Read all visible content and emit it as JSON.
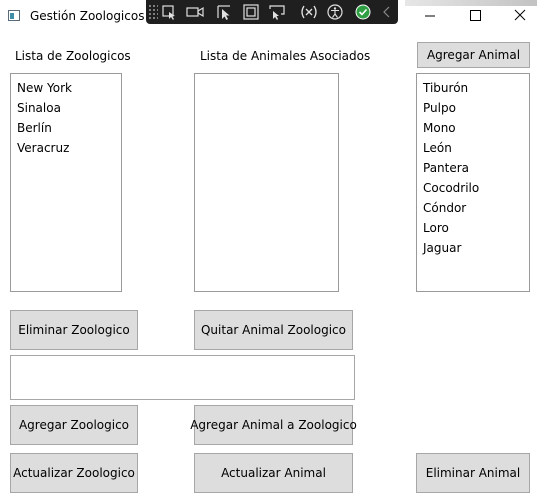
{
  "window": {
    "title": "Gestión Zoologicos",
    "icons": {
      "app": "app-window-icon",
      "minimize": "minimize-icon",
      "maximize": "maximize-icon",
      "close": "close-icon"
    }
  },
  "debug_toolbar": {
    "icons": [
      "select-element-icon",
      "video-record-icon",
      "pointer-select-icon",
      "display-layout-adorners-icon",
      "track-focus-icon",
      "binding-failures-icon",
      "accessibility-icon",
      "hot-reload-check-icon",
      "collapse-chevron-icon"
    ]
  },
  "labels": {
    "zoo_list": "Lista de Zoologicos",
    "animals_list": "Lista de Animales Asociados"
  },
  "zoos": [
    "New York",
    "Sinaloa",
    "Berlín",
    "Veracruz"
  ],
  "associated_animals": [],
  "animals": [
    "Tiburón",
    "Pulpo",
    "Mono",
    "León",
    "Pantera",
    "Cocodrilo",
    "Cóndor",
    "Loro",
    "Jaguar"
  ],
  "input": {
    "value": ""
  },
  "buttons": {
    "add_animal": "Agregar Animal",
    "delete_zoo": "Eliminar Zoologico",
    "remove_zoo_animal": "Quitar Animal Zoologico",
    "add_zoo": "Agregar Zoologico",
    "add_animal_to_zoo": "Agregar Animal a Zoologico",
    "update_zoo": "Actualizar Zoologico",
    "update_animal": "Actualizar Animal",
    "delete_animal": "Eliminar Animal"
  }
}
